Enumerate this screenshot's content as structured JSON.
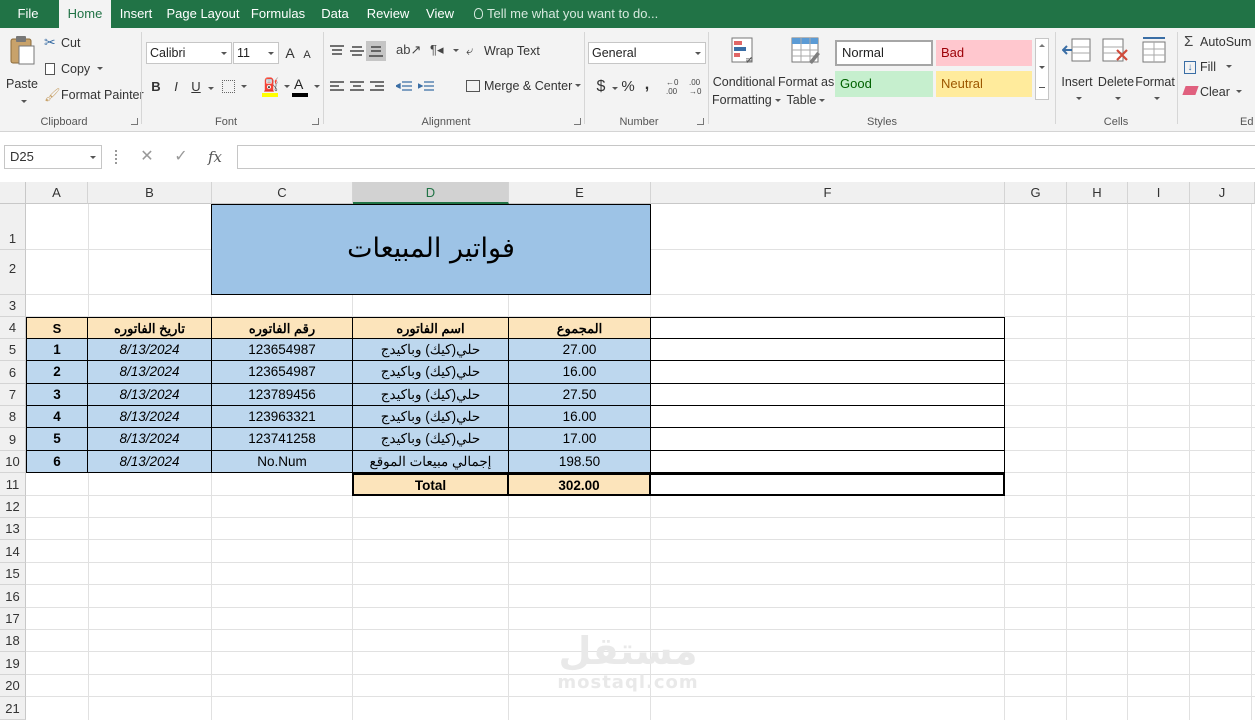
{
  "menu": {
    "tabs": [
      "File",
      "Home",
      "Insert",
      "Page Layout",
      "Formulas",
      "Data",
      "Review",
      "View"
    ],
    "active_tab": "Home",
    "tell_me": "Tell me what you want to do..."
  },
  "ribbon": {
    "clipboard": {
      "paste": "Paste",
      "cut": "Cut",
      "copy": "Copy",
      "format_painter": "Format Painter",
      "label": "Clipboard"
    },
    "font": {
      "name": "Calibri",
      "size": "11",
      "grow": "A",
      "shrink": "A",
      "bold": "B",
      "italic": "I",
      "underline": "U",
      "font_color_letter": "A",
      "label": "Font"
    },
    "alignment": {
      "wrap_text": "Wrap Text",
      "merge_center": "Merge & Center",
      "label": "Alignment"
    },
    "number": {
      "format": "General",
      "currency": "$",
      "percent": "%",
      "comma": ",",
      "label": "Number"
    },
    "styles": {
      "conditional_formatting_1": "Conditional",
      "conditional_formatting_2": "Formatting",
      "format_as_table_1": "Format as",
      "format_as_table_2": "Table",
      "normal": "Normal",
      "bad": "Bad",
      "good": "Good",
      "neutral": "Neutral",
      "label": "Styles"
    },
    "cells": {
      "insert": "Insert",
      "delete": "Delete",
      "format": "Format",
      "label": "Cells"
    },
    "editing": {
      "autosum": "AutoSum",
      "fill": "Fill",
      "clear": "Clear",
      "label_partial": "Ed"
    }
  },
  "formula_bar": {
    "name_box": "D25",
    "cancel_symbol": "✕",
    "enter_symbol": "✓",
    "fx": "fx",
    "content": ""
  },
  "grid": {
    "columns": [
      "A",
      "B",
      "C",
      "D",
      "E",
      "F",
      "G",
      "H",
      "I",
      "J"
    ],
    "selected_column": "D",
    "rows": [
      "1",
      "2",
      "3",
      "4",
      "5",
      "6",
      "7",
      "8",
      "9",
      "10",
      "11",
      "12",
      "13",
      "14",
      "15",
      "16",
      "17",
      "18",
      "19",
      "20",
      "21"
    ]
  },
  "sheet": {
    "title": "فواتير المبيعات",
    "headers": {
      "s": "S",
      "date": "تاريخ الفاتوره",
      "number": "رقم الفاتوره",
      "name": "اسم الفاتوره",
      "total": "المجموع"
    },
    "rows": [
      {
        "s": "1",
        "date": "8/13/2024",
        "number": "123654987",
        "name": "حلي(كيك) وباكيدج",
        "total": "27.00"
      },
      {
        "s": "2",
        "date": "8/13/2024",
        "number": "123654987",
        "name": "حلي(كيك) وباكيدج",
        "total": "16.00"
      },
      {
        "s": "3",
        "date": "8/13/2024",
        "number": "123789456",
        "name": "حلي(كيك) وباكيدج",
        "total": "27.50"
      },
      {
        "s": "4",
        "date": "8/13/2024",
        "number": "123963321",
        "name": "حلي(كيك) وباكيدج",
        "total": "16.00"
      },
      {
        "s": "5",
        "date": "8/13/2024",
        "number": "123741258",
        "name": "حلي(كيك) وباكيدج",
        "total": "17.00"
      },
      {
        "s": "6",
        "date": "8/13/2024",
        "number": "No.Num",
        "name": "إجمالي مبيعات الموقع",
        "total": "198.50"
      }
    ],
    "total_label": "Total",
    "total_value": "302.00"
  },
  "watermark": {
    "arabic": "مستقل",
    "latin": "mostaql.com"
  },
  "colors": {
    "excel_green": "#217346",
    "header_fill": "#fce4bb",
    "row_fill": "#bdd7ee",
    "title_fill": "#9dc3e6",
    "style_bad": "#ffc7ce",
    "style_good": "#c6efce",
    "style_neutral": "#ffeb9c"
  }
}
